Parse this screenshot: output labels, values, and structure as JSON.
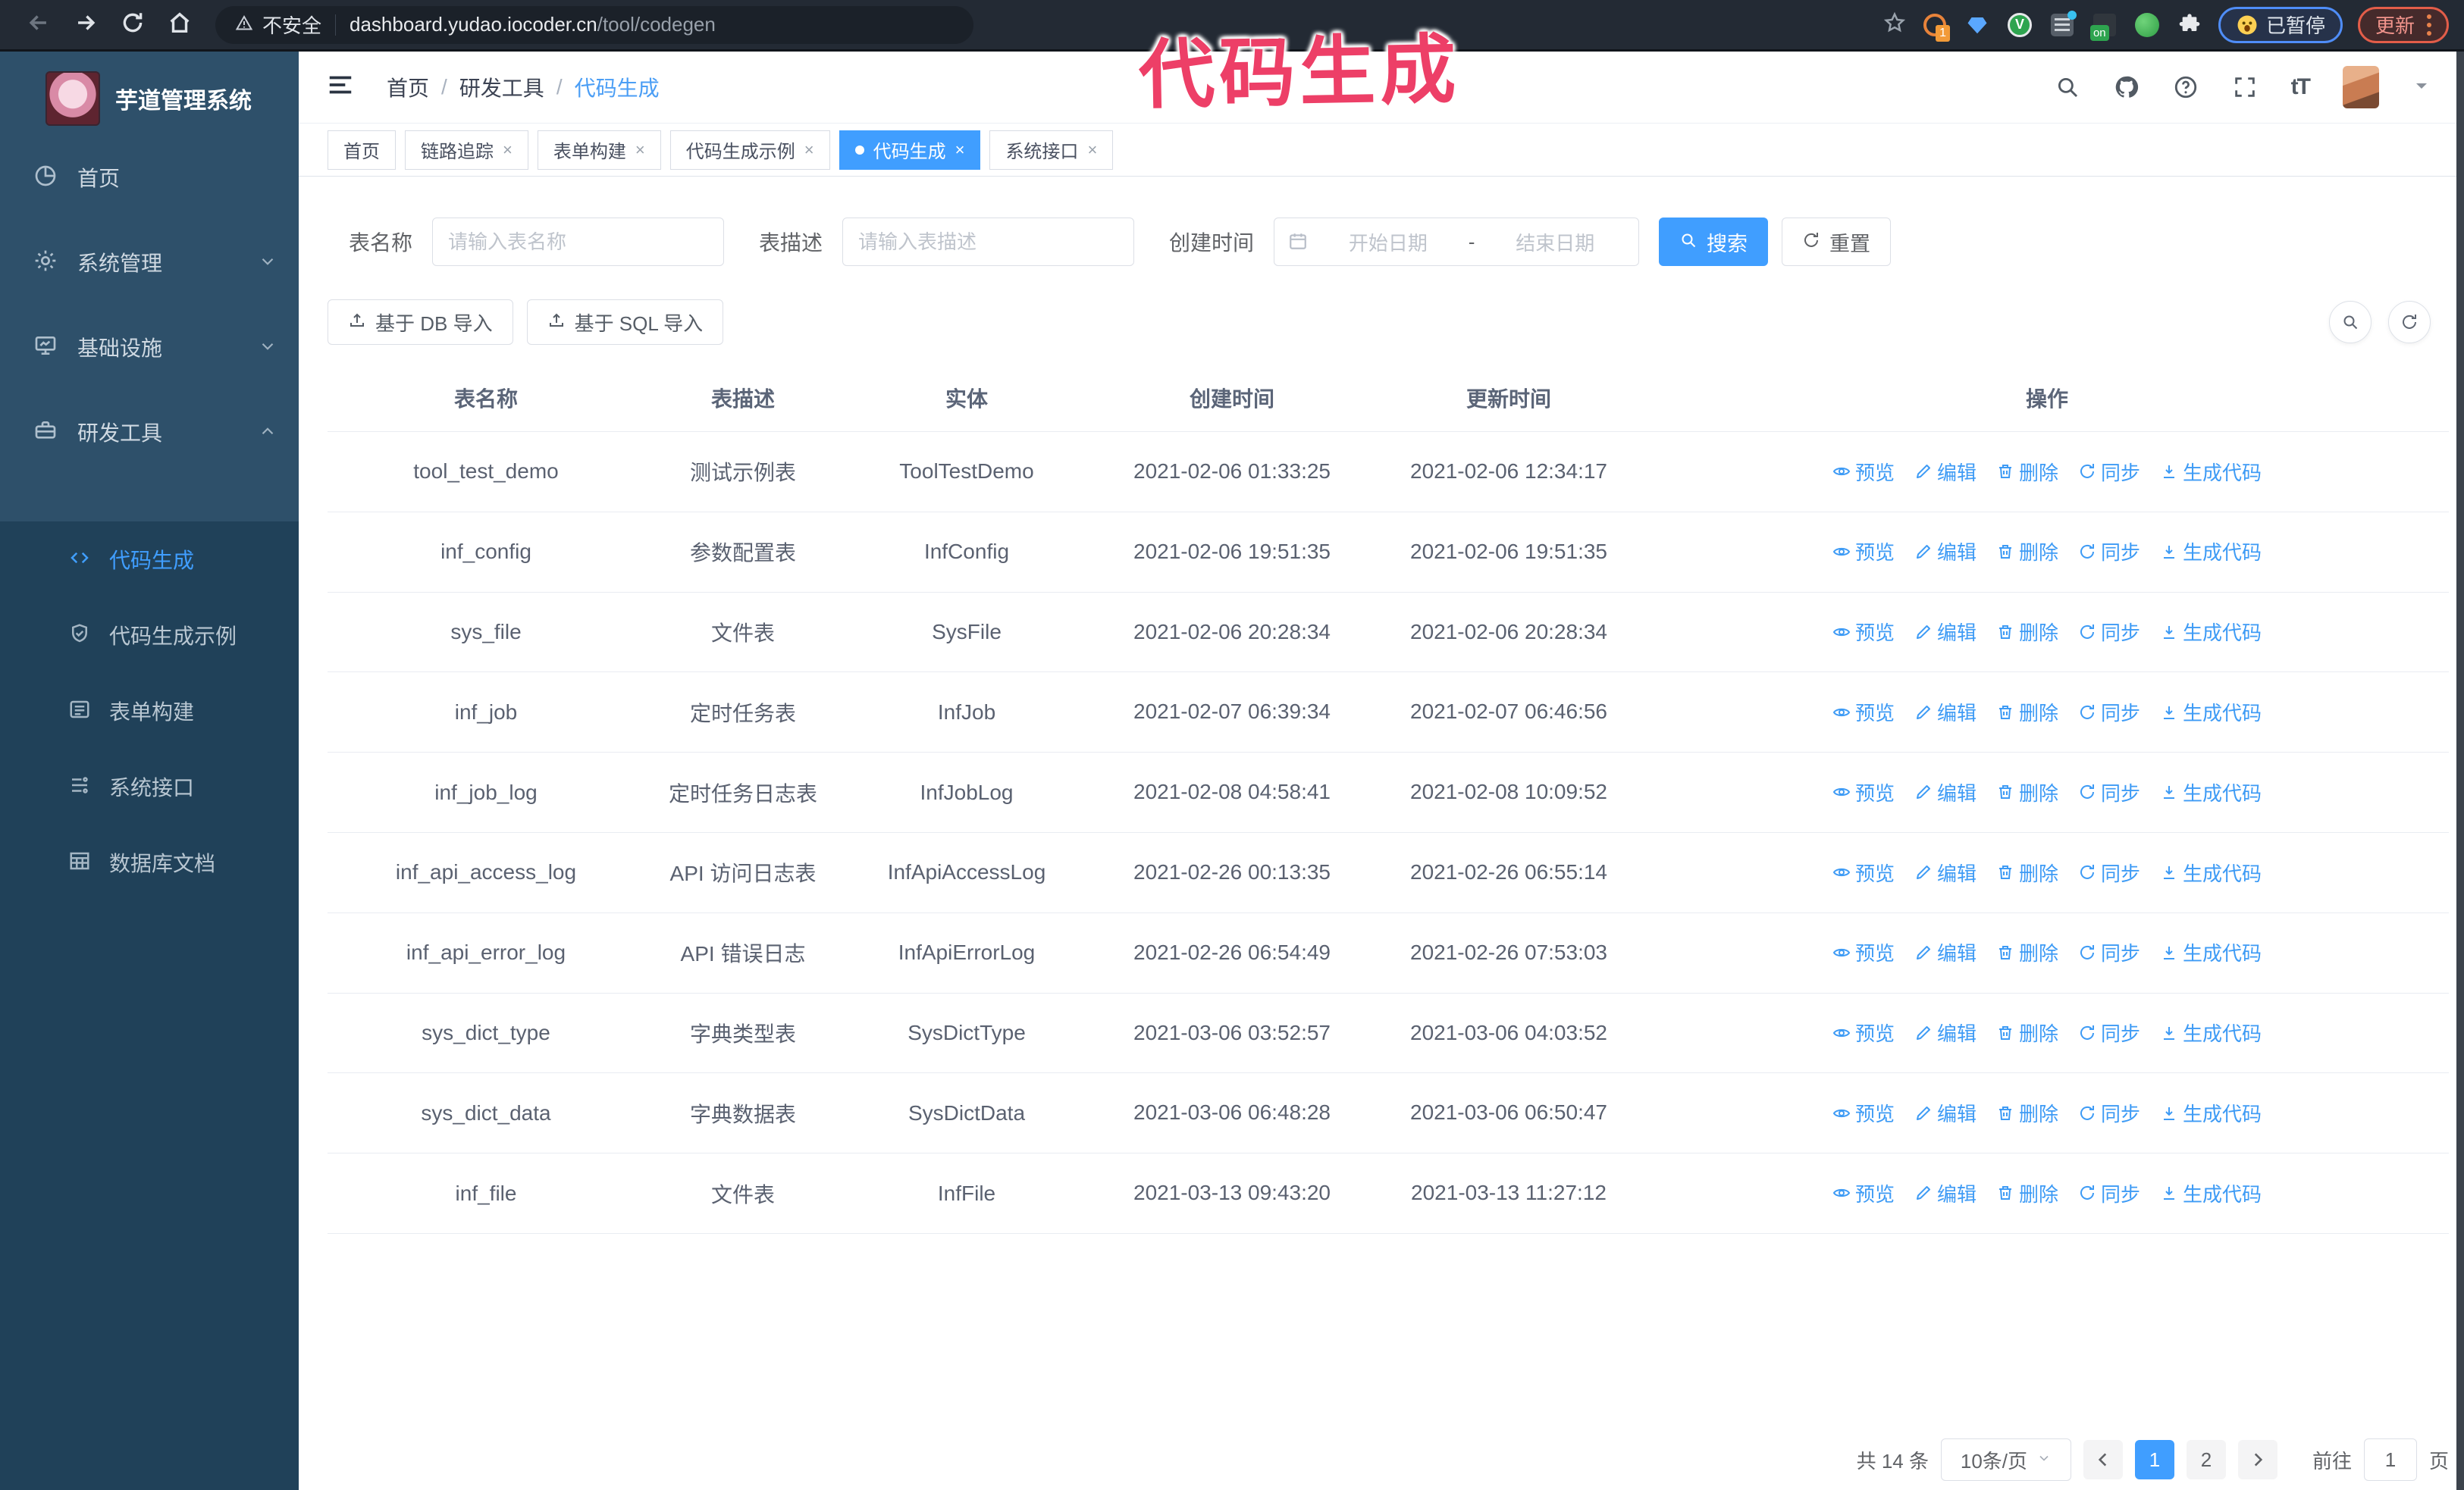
{
  "browser": {
    "security_label": "不安全",
    "url_host": "dashboard.yudao.iocoder.cn",
    "url_path": "/tool/codegen",
    "extension_count_badge": "1",
    "extension_on_badge": "on",
    "extension_green_letter": "V",
    "paused_badge": "已暂停",
    "update_button": "更新"
  },
  "annotation": {
    "text": "代码生成",
    "color": "#ed3f67"
  },
  "sidebar": {
    "title": "芋道管理系统",
    "items": [
      {
        "label": "首页",
        "icon": "dashboard-icon"
      },
      {
        "label": "系统管理",
        "icon": "gear-icon",
        "state": "collapsed"
      },
      {
        "label": "基础设施",
        "icon": "monitor-icon",
        "state": "collapsed"
      },
      {
        "label": "研发工具",
        "icon": "toolbox-icon",
        "state": "expanded"
      }
    ],
    "submenu": [
      {
        "label": "代码生成",
        "icon": "code-icon",
        "active": true
      },
      {
        "label": "代码生成示例",
        "icon": "badge-check-icon",
        "active": false
      },
      {
        "label": "表单构建",
        "icon": "form-icon",
        "active": false
      },
      {
        "label": "系统接口",
        "icon": "api-list-icon",
        "active": false
      },
      {
        "label": "数据库文档",
        "icon": "db-table-icon",
        "active": false
      }
    ]
  },
  "breadcrumb": {
    "items": [
      "首页",
      "研发工具",
      "代码生成"
    ],
    "separator": "/"
  },
  "tabs": [
    {
      "label": "首页",
      "closable": false,
      "active": false
    },
    {
      "label": "链路追踪",
      "closable": true,
      "active": false
    },
    {
      "label": "表单构建",
      "closable": true,
      "active": false
    },
    {
      "label": "代码生成示例",
      "closable": true,
      "active": false
    },
    {
      "label": "代码生成",
      "closable": true,
      "active": true
    },
    {
      "label": "系统接口",
      "closable": true,
      "active": false
    }
  ],
  "header": {
    "font_size_icon_text": "tT"
  },
  "filters": {
    "table_name_label": "表名称",
    "table_name_placeholder": "请输入表名称",
    "table_desc_label": "表描述",
    "table_desc_placeholder": "请输入表描述",
    "create_time_label": "创建时间",
    "date_start_placeholder": "开始日期",
    "date_separator": "-",
    "date_end_placeholder": "结束日期",
    "search_button": "搜索",
    "reset_button": "重置"
  },
  "toolbar": {
    "import_db_button": "基于 DB 导入",
    "import_sql_button": "基于 SQL 导入"
  },
  "table": {
    "columns": [
      "表名称",
      "表描述",
      "实体",
      "创建时间",
      "更新时间",
      "操作"
    ],
    "actions": [
      {
        "key": "preview",
        "label": "预览"
      },
      {
        "key": "edit",
        "label": "编辑"
      },
      {
        "key": "delete",
        "label": "删除"
      },
      {
        "key": "sync",
        "label": "同步"
      },
      {
        "key": "generate",
        "label": "生成代码"
      }
    ],
    "rows": [
      {
        "name": "tool_test_demo",
        "description": "测试示例表",
        "entity": "ToolTestDemo",
        "create_time": "2021-02-06 01:33:25",
        "update_time": "2021-02-06 12:34:17"
      },
      {
        "name": "inf_config",
        "description": "参数配置表",
        "entity": "InfConfig",
        "create_time": "2021-02-06 19:51:35",
        "update_time": "2021-02-06 19:51:35"
      },
      {
        "name": "sys_file",
        "description": "文件表",
        "entity": "SysFile",
        "create_time": "2021-02-06 20:28:34",
        "update_time": "2021-02-06 20:28:34"
      },
      {
        "name": "inf_job",
        "description": "定时任务表",
        "entity": "InfJob",
        "create_time": "2021-02-07 06:39:34",
        "update_time": "2021-02-07 06:46:56"
      },
      {
        "name": "inf_job_log",
        "description": "定时任务日志表",
        "entity": "InfJobLog",
        "create_time": "2021-02-08 04:58:41",
        "update_time": "2021-02-08 10:09:52"
      },
      {
        "name": "inf_api_access_log",
        "description": "API 访问日志表",
        "entity": "InfApiAccessLog",
        "create_time": "2021-02-26 00:13:35",
        "update_time": "2021-02-26 06:55:14"
      },
      {
        "name": "inf_api_error_log",
        "description": "API 错误日志",
        "entity": "InfApiErrorLog",
        "create_time": "2021-02-26 06:54:49",
        "update_time": "2021-02-26 07:53:03"
      },
      {
        "name": "sys_dict_type",
        "description": "字典类型表",
        "entity": "SysDictType",
        "create_time": "2021-03-06 03:52:57",
        "update_time": "2021-03-06 04:03:52"
      },
      {
        "name": "sys_dict_data",
        "description": "字典数据表",
        "entity": "SysDictData",
        "create_time": "2021-03-06 06:48:28",
        "update_time": "2021-03-06 06:50:47"
      },
      {
        "name": "inf_file",
        "description": "文件表",
        "entity": "InfFile",
        "create_time": "2021-03-13 09:43:20",
        "update_time": "2021-03-13 11:27:12"
      }
    ]
  },
  "pagination": {
    "total": "共 14 条",
    "page_size": "10条/页",
    "pages": [
      "1",
      "2"
    ],
    "active_page": "1",
    "jump_label": "前往",
    "jump_value": "1",
    "jump_unit": "页"
  },
  "colors": {
    "primary": "#409eff",
    "sidebar_bg": "#2e506a",
    "submenu_bg": "#204159",
    "annotation": "#ed3f67"
  }
}
